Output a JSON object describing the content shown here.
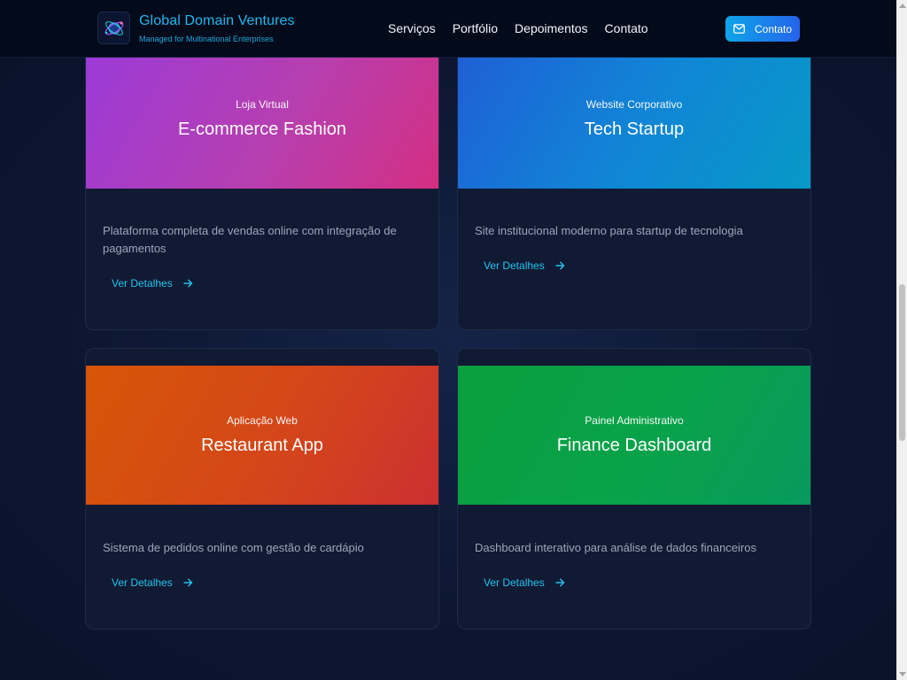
{
  "header": {
    "brand_title": "Global Domain Ventures",
    "brand_subtitle": "Managed for Multinational Enterprises",
    "logo_icon": "globe-orbit-icon",
    "nav": [
      "Serviços",
      "Portfólio",
      "Depoimentos",
      "Contato"
    ],
    "cta_label": "Contato",
    "cta_icon": "mail-icon"
  },
  "colors": {
    "accent": "#22b8f0",
    "link": "#22c3ee",
    "background": "#0d1732",
    "card": "#111a33"
  },
  "projects": [
    {
      "category": "Loja Virtual",
      "title": "E-commerce Fashion",
      "description": "Plataforma completa de vendas online com integração de pagamentos",
      "link": "Ver Detalhes",
      "gradient": [
        "#9b3ad8",
        "#d42f82"
      ]
    },
    {
      "category": "Website Corporativo",
      "title": "Tech Startup",
      "description": "Site institucional moderno para startup de tecnologia",
      "link": "Ver Detalhes",
      "gradient": [
        "#1f5fd6",
        "#0799c7"
      ]
    },
    {
      "category": "Aplicação Web",
      "title": "Restaurant App",
      "description": "Sistema de pedidos online com gestão de cardápio",
      "link": "Ver Detalhes",
      "gradient": [
        "#d75607",
        "#cc2f31"
      ]
    },
    {
      "category": "Painel Administrativo",
      "title": "Finance Dashboard",
      "description": "Dashboard interativo para análise de dados financeiros",
      "link": "Ver Detalhes",
      "gradient": [
        "#0a9f3f",
        "#079a5d"
      ]
    }
  ]
}
